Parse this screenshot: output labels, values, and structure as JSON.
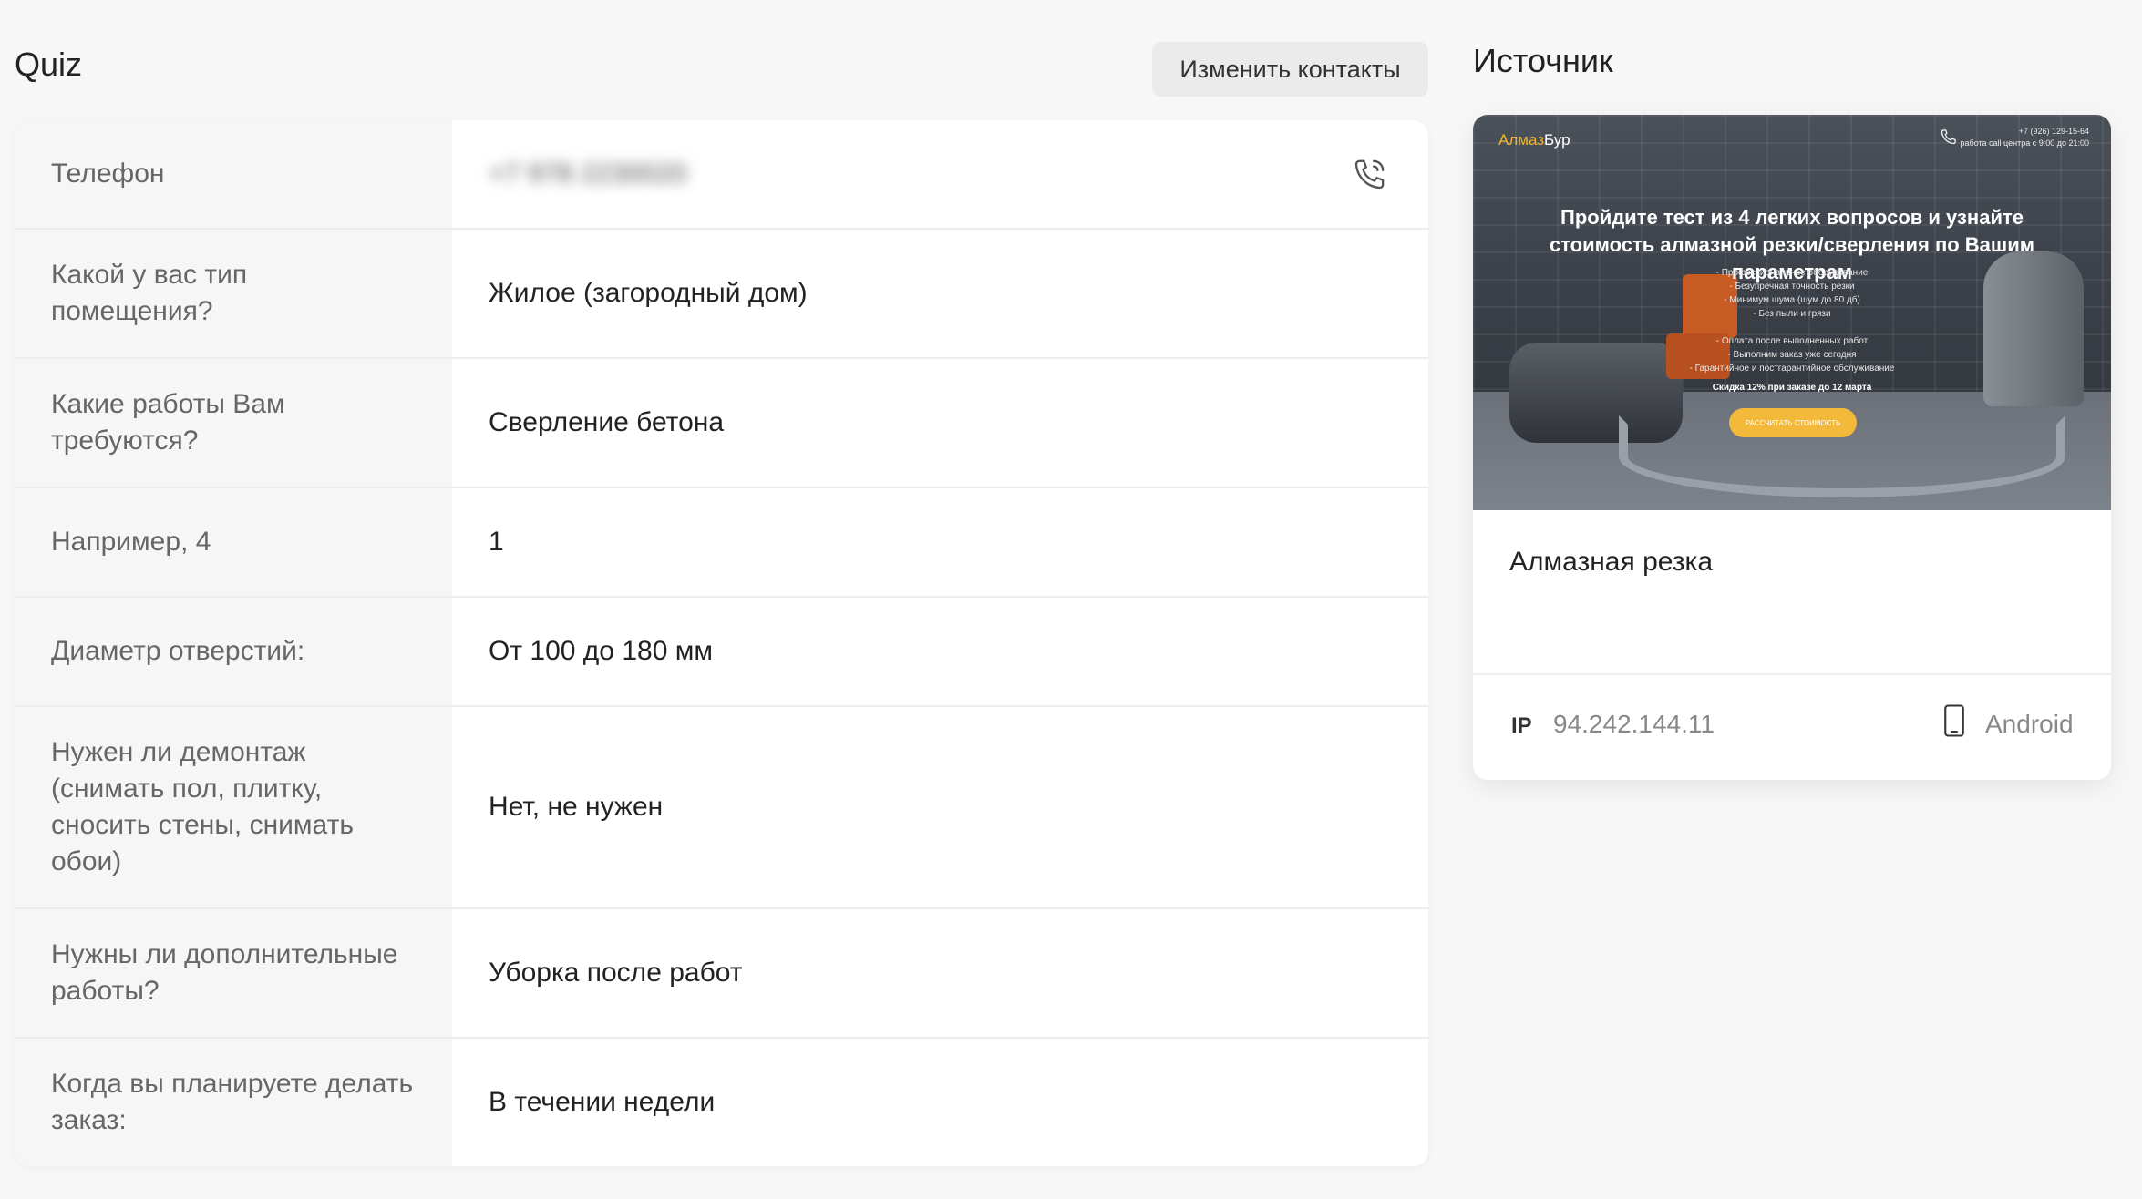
{
  "quiz": {
    "title": "Quiz",
    "edit_contacts_label": "Изменить контакты",
    "phone_label": "Телефон",
    "phone_value": "+7 978 2230020",
    "rows": [
      {
        "question": "Какой у вас тип помещения?",
        "answer": "Жилое (загородный дом)"
      },
      {
        "question": "Какие работы Вам требуются?",
        "answer": "Сверление бетона"
      },
      {
        "question": "Например, 4",
        "answer": "1"
      },
      {
        "question": "Диаметр отверстий:",
        "answer": "От 100 до 180 мм"
      },
      {
        "question": "Нужен ли демонтаж (снимать пол, плитку, сносить стены, снимать обои)",
        "answer": "Нет, не нужен"
      },
      {
        "question": "Нужны ли дополнительные работы?",
        "answer": "Уборка после работ"
      },
      {
        "question": "Когда вы планируете делать заказ:",
        "answer": "В течении недели"
      }
    ]
  },
  "source": {
    "title": "Источник",
    "preview": {
      "logo_accent": "Алмаз",
      "logo_rest": "Бур",
      "phone": "+7 (926) 129-15-64",
      "hours": "работа call центра с 9:00 до 21:00",
      "headline": "Пройдите тест из 4 легких вопросов и узнайте стоимость алмазной резки/сверления по Вашим параметрам",
      "bullets": "- Профессиональное оборудование\n- Безупречная точность резки\n- Минимум шума (шум до 80 дб)\n- Без пыли и грязи\n\n- Оплата после выполненных работ\n- Выполним заказ уже сегодня\n- Гарантийное и постгарантийное обслуживание",
      "discount": "Скидка 12% при заказе до 12 марта",
      "cta": "РАССЧИТАТЬ СТОИМОСТЬ"
    },
    "name": "Алмазная резка",
    "ip_label": "IP",
    "ip_value": "94.242.144.11",
    "device": "Android",
    "device_icon": "smartphone-icon",
    "call_icon": "phone-call-icon",
    "accent_color": "#f2b93b"
  }
}
